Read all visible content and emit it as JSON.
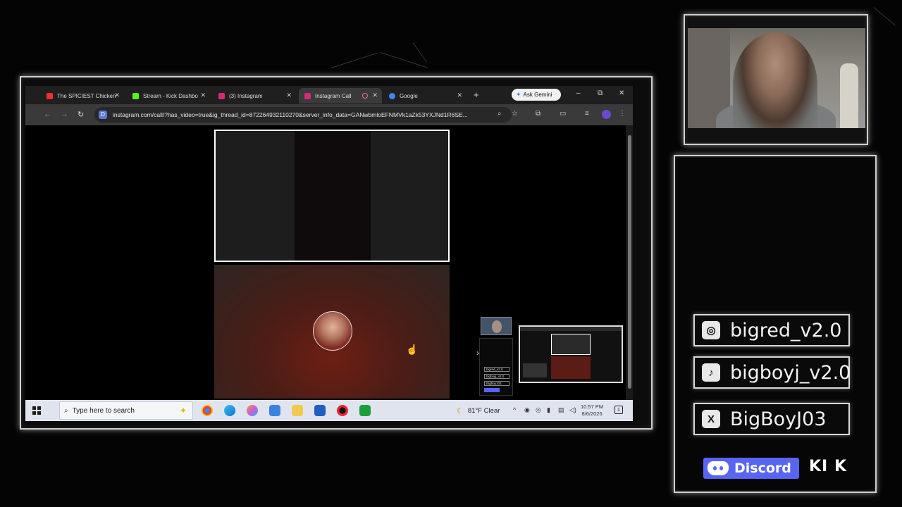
{
  "browser": {
    "tabs": [
      {
        "label": "The SPICIEST Chicken",
        "favicon_color": "#ff2a2a"
      },
      {
        "label": "Stream - Kick Dashbo",
        "favicon_color": "#53fc18"
      },
      {
        "label": "(3) Instagram",
        "favicon_color": "#d62976"
      },
      {
        "label": "Instagram Call",
        "favicon_color": "#d62976"
      },
      {
        "label": "Google",
        "favicon_color": "#4285f4"
      }
    ],
    "new_tab": "+",
    "gemini_label": "Ask Gemini",
    "url": "instagram.com/call/?has_video=true&ig_thread_id=872264932110270&server_info_data=GANwbmloEFNMVk1aZk53YXJNd1R6SE...",
    "window_controls": {
      "minimize": "–",
      "restore": "⧉",
      "close": "✕"
    }
  },
  "taskbar": {
    "search_placeholder": "Type here to search",
    "weather": "81°F  Clear",
    "time": "10:57 PM",
    "date": "8/6/2026",
    "notification_count": "1"
  },
  "mini_preview": {
    "socials": [
      "bigred_v2.0",
      "bigboyj_v2.0",
      "BigBoyJ03"
    ]
  },
  "socials": {
    "instagram": "bigred_v2.0",
    "tiktok": "bigboyj_v2.0",
    "x": "BigBoyJ03",
    "discord": "Discord",
    "kick_partial": "KI",
    "kick_k": "K"
  },
  "colors": {
    "discord": "#5865f2",
    "instagram_pink": "#d62976",
    "kick_green": "#53fc18",
    "taskbar": "#dfe4ee"
  }
}
